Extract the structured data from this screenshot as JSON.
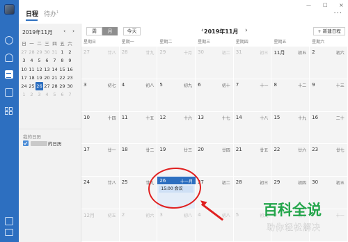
{
  "tabs": {
    "schedule": "日程",
    "todo": "待办",
    "todo_count": "1"
  },
  "window_controls": {
    "minimize": "—",
    "maximize": "□",
    "close": "×",
    "more": "···"
  },
  "mini_calendar": {
    "title": "2019年11月",
    "prev": "‹",
    "next": "›",
    "weekdays": [
      "日",
      "一",
      "二",
      "三",
      "四",
      "五",
      "六"
    ],
    "weeks": [
      [
        "27",
        "28",
        "29",
        "30",
        "31",
        "1",
        "2"
      ],
      [
        "3",
        "4",
        "5",
        "6",
        "7",
        "8",
        "9"
      ],
      [
        "10",
        "11",
        "12",
        "13",
        "14",
        "15",
        "16"
      ],
      [
        "17",
        "18",
        "19",
        "20",
        "21",
        "22",
        "23"
      ],
      [
        "24",
        "25",
        "26",
        "27",
        "28",
        "29",
        "30"
      ],
      [
        "1",
        "2",
        "3",
        "4",
        "5",
        "6",
        "7"
      ]
    ]
  },
  "my_calendars": {
    "label": "我的日历",
    "item_suffix": "的日历"
  },
  "toolbar": {
    "week": "周",
    "month": "月",
    "today": "今天",
    "title": "2019年11月",
    "prev": "‹",
    "next": "›",
    "new_event": "+ 新建日程"
  },
  "weekday_headers": [
    "星期日",
    "星期一",
    "星期二",
    "星期三",
    "星期四",
    "星期五",
    "星期六"
  ],
  "month_grid": [
    [
      {
        "d": "27",
        "l": "廿八"
      },
      {
        "d": "28",
        "l": "廿九"
      },
      {
        "d": "29",
        "l": "十月"
      },
      {
        "d": "30",
        "l": "初二"
      },
      {
        "d": "31",
        "l": "初三"
      },
      {
        "d": "11月",
        "l": "初五"
      },
      {
        "d": "2",
        "l": "初六"
      }
    ],
    [
      {
        "d": "3",
        "l": "初七"
      },
      {
        "d": "4",
        "l": "初八"
      },
      {
        "d": "5",
        "l": "初九"
      },
      {
        "d": "6",
        "l": "初十"
      },
      {
        "d": "7",
        "l": "十一"
      },
      {
        "d": "8",
        "l": "十二"
      },
      {
        "d": "9",
        "l": "十三"
      }
    ],
    [
      {
        "d": "10",
        "l": "十四"
      },
      {
        "d": "11",
        "l": "十五"
      },
      {
        "d": "12",
        "l": "十六"
      },
      {
        "d": "13",
        "l": "十七"
      },
      {
        "d": "14",
        "l": "十八"
      },
      {
        "d": "15",
        "l": "十九"
      },
      {
        "d": "16",
        "l": "二十"
      }
    ],
    [
      {
        "d": "17",
        "l": "廿一"
      },
      {
        "d": "18",
        "l": "廿二"
      },
      {
        "d": "19",
        "l": "廿三"
      },
      {
        "d": "20",
        "l": "廿四"
      },
      {
        "d": "21",
        "l": "廿五"
      },
      {
        "d": "22",
        "l": "廿六"
      },
      {
        "d": "23",
        "l": "廿七"
      }
    ],
    [
      {
        "d": "24",
        "l": "廿八"
      },
      {
        "d": "25",
        "l": "廿九"
      },
      {
        "d": "26",
        "l": "十一月"
      },
      {
        "d": "27",
        "l": "初二"
      },
      {
        "d": "28",
        "l": "初三"
      },
      {
        "d": "29",
        "l": "初四"
      },
      {
        "d": "30",
        "l": "初五"
      }
    ],
    [
      {
        "d": "12月",
        "l": "初五"
      },
      {
        "d": "2",
        "l": "初六"
      },
      {
        "d": "3",
        "l": "初八"
      },
      {
        "d": "4",
        "l": "初八"
      },
      {
        "d": "5",
        "l": "初九"
      },
      {
        "d": "6",
        "l": "初十"
      },
      {
        "d": "7",
        "l": "十一"
      }
    ]
  ],
  "event": {
    "time": "15:00",
    "title": "会议"
  },
  "watermark": {
    "title": "百科全说",
    "subtitle": "助你轻松解决"
  },
  "colors": {
    "accent": "#2d6fc0",
    "annotation": "#e02020",
    "watermark": "#22a54a"
  }
}
